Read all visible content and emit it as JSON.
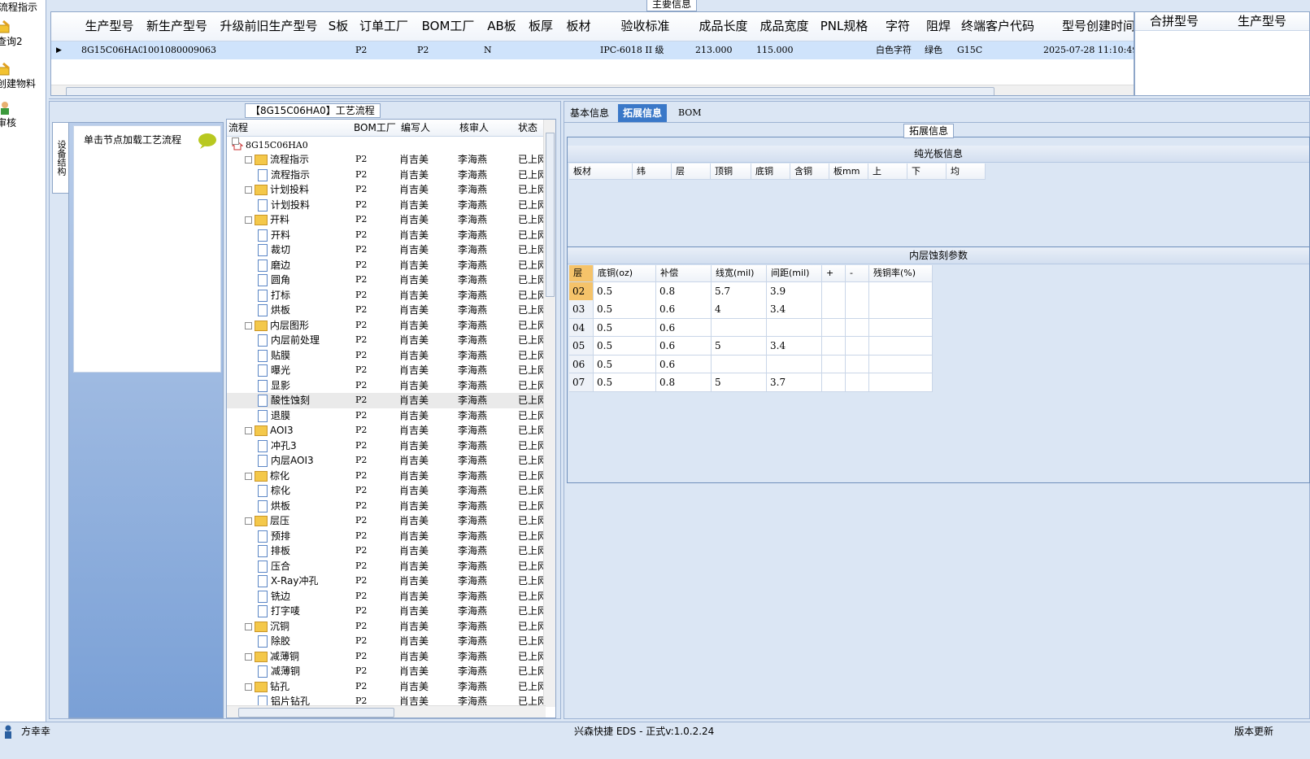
{
  "leftnav": {
    "items": [
      {
        "label": "流程指示",
        "icon": "process-icon"
      },
      {
        "label": "查询2",
        "icon": "folder-pencil-icon"
      },
      {
        "label": "创建物料",
        "icon": "folder-pencil-icon"
      },
      {
        "label": "审核",
        "icon": "user-check-icon"
      }
    ]
  },
  "top": {
    "legend": "主要信息",
    "columns": [
      "生产型号",
      "新生产型号",
      "升级前旧生产型号",
      "S板",
      "订单工厂",
      "BOM工厂",
      "AB板",
      "板厚",
      "板材",
      "验收标准",
      "成品长度",
      "成品宽度",
      "PNL规格",
      "字符",
      "阻焊",
      "终端客户代码",
      "型号创建时间"
    ],
    "row": [
      "8G15C06HA0",
      "10010800090635",
      "",
      "",
      "P2",
      "P2",
      "N",
      "",
      "",
      "IPC-6018 II 级",
      "213.000",
      "115.000",
      "",
      "白色字符",
      "绿色",
      "G15C",
      "2025-07-28 11:10:49"
    ],
    "side_columns": [
      "合拼型号",
      "生产型号"
    ]
  },
  "process": {
    "legend": "【8G15C06HA0】工艺流程",
    "vtab": "设备结构",
    "card_text": "单击节点加载工艺流程",
    "tree_headers": [
      "流程",
      "BOM工厂",
      "编写人",
      "核审人",
      "状态"
    ],
    "root": "8G15C06HA0",
    "rows": [
      {
        "name": "流程指示",
        "level": 1,
        "group": true
      },
      {
        "name": "流程指示",
        "level": 2
      },
      {
        "name": "计划投料",
        "level": 1,
        "group": true
      },
      {
        "name": "计划投料",
        "level": 2
      },
      {
        "name": "开料",
        "level": 1,
        "group": true
      },
      {
        "name": "开料",
        "level": 2
      },
      {
        "name": "裁切",
        "level": 2
      },
      {
        "name": "磨边",
        "level": 2
      },
      {
        "name": "圆角",
        "level": 2
      },
      {
        "name": "打标",
        "level": 2
      },
      {
        "name": "烘板",
        "level": 2
      },
      {
        "name": "内层图形",
        "level": 1,
        "group": true
      },
      {
        "name": "内层前处理",
        "level": 2
      },
      {
        "name": "贴膜",
        "level": 2
      },
      {
        "name": "曝光",
        "level": 2
      },
      {
        "name": "显影",
        "level": 2
      },
      {
        "name": "酸性蚀刻",
        "level": 2,
        "selected": true
      },
      {
        "name": "退膜",
        "level": 2
      },
      {
        "name": "AOI3",
        "level": 1,
        "group": true
      },
      {
        "name": "冲孔3",
        "level": 2
      },
      {
        "name": "内层AOI3",
        "level": 2
      },
      {
        "name": "棕化",
        "level": 1,
        "group": true
      },
      {
        "name": "棕化",
        "level": 2
      },
      {
        "name": "烘板",
        "level": 2
      },
      {
        "name": "层压",
        "level": 1,
        "group": true
      },
      {
        "name": "预排",
        "level": 2
      },
      {
        "name": "排板",
        "level": 2
      },
      {
        "name": "压合",
        "level": 2
      },
      {
        "name": "X-Ray冲孔",
        "level": 2
      },
      {
        "name": "铣边",
        "level": 2
      },
      {
        "name": "打字唛",
        "level": 2
      },
      {
        "name": "沉铜",
        "level": 1,
        "group": true
      },
      {
        "name": "除胶",
        "level": 2
      },
      {
        "name": "减薄铜",
        "level": 1,
        "group": true
      },
      {
        "name": "减薄铜",
        "level": 2
      },
      {
        "name": "钻孔",
        "level": 1,
        "group": true
      },
      {
        "name": "铝片钻孔",
        "level": 2
      }
    ],
    "bom_factory": "P2",
    "writer": "肖吉美",
    "reviewer": "李海燕",
    "status": "已上网"
  },
  "right": {
    "tabs": [
      "基本信息",
      "拓展信息",
      "BOM"
    ],
    "active_tab": "拓展信息",
    "legend": "拓展信息",
    "plain_board": {
      "title": "纯光板信息",
      "headers": [
        "板材",
        "纬",
        "层",
        "顶铜",
        "底铜",
        "含铜",
        "板mm",
        "上",
        "下",
        "均"
      ]
    },
    "etch": {
      "title": "内层蚀刻参数",
      "headers": [
        "层",
        "底铜(oz)",
        "补偿",
        "线宽(mil)",
        "间距(mil)",
        "+",
        "-",
        "残铜率(%)"
      ],
      "rows": [
        [
          "02",
          "0.5",
          "0.8",
          "5.7",
          "3.9",
          "",
          "",
          ""
        ],
        [
          "03",
          "0.5",
          "0.6",
          "4",
          "3.4",
          "",
          "",
          ""
        ],
        [
          "04",
          "0.5",
          "0.6",
          "",
          "",
          "",
          "",
          ""
        ],
        [
          "05",
          "0.5",
          "0.6",
          "5",
          "3.4",
          "",
          "",
          ""
        ],
        [
          "06",
          "0.5",
          "0.6",
          "",
          "",
          "",
          "",
          ""
        ],
        [
          "07",
          "0.5",
          "0.8",
          "5",
          "3.7",
          "",
          "",
          ""
        ]
      ]
    }
  },
  "status": {
    "user": "方幸幸",
    "app": "兴森快捷 EDS - 正式v:1.0.2.24",
    "update": "版本更新"
  },
  "colors": {
    "selected_row": "#cfe3fb",
    "active_tab": "#3a78c8",
    "panel_bg": "#dbe6f4"
  }
}
